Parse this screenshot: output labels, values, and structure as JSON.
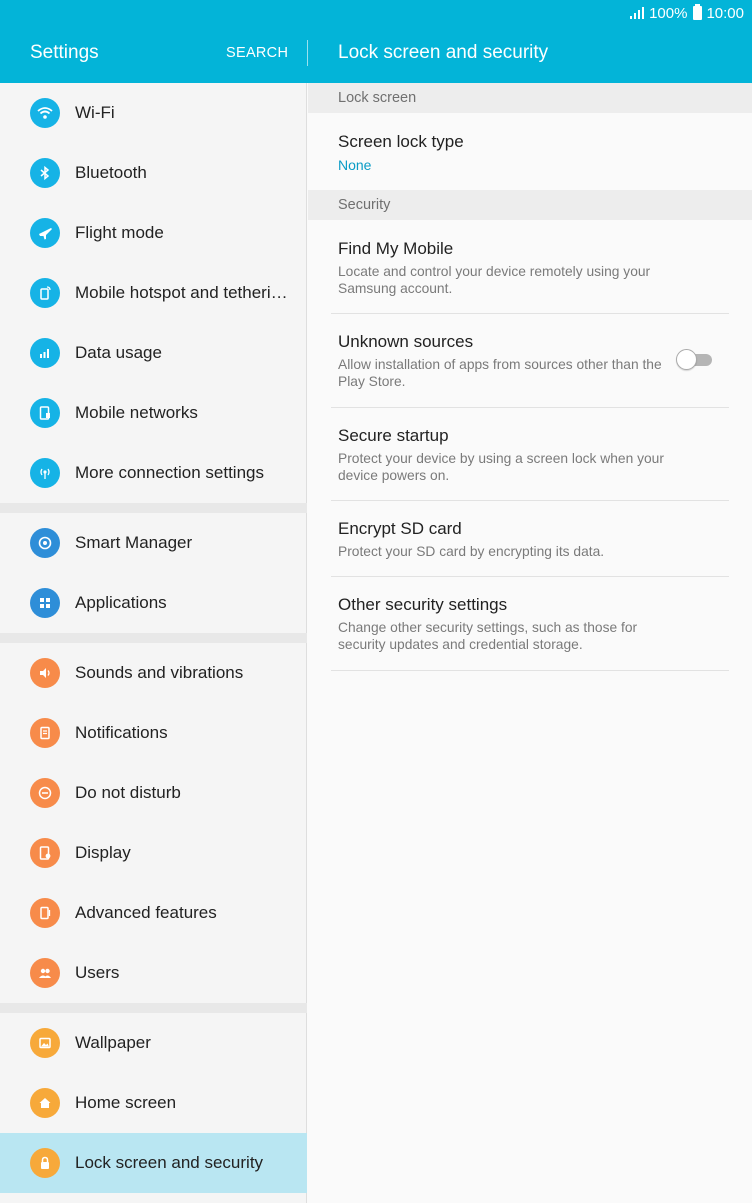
{
  "status_bar": {
    "battery": "100%",
    "time": "10:00"
  },
  "header": {
    "title": "Settings",
    "search_label": "SEARCH",
    "detail_title": "Lock screen and security"
  },
  "sidebar": {
    "items": [
      {
        "label": "Wi-Fi",
        "icon": "wifi-icon"
      },
      {
        "label": "Bluetooth",
        "icon": "bluetooth-icon"
      },
      {
        "label": "Flight mode",
        "icon": "airplane-icon"
      },
      {
        "label": "Mobile hotspot and tetheri…",
        "icon": "hotspot-icon"
      },
      {
        "label": "Data usage",
        "icon": "data-usage-icon"
      },
      {
        "label": "Mobile networks",
        "icon": "mobile-networks-icon"
      },
      {
        "label": "More connection settings",
        "icon": "connection-icon"
      },
      {
        "label": "Smart Manager",
        "icon": "smart-manager-icon"
      },
      {
        "label": "Applications",
        "icon": "applications-icon"
      },
      {
        "label": "Sounds and vibrations",
        "icon": "sound-icon"
      },
      {
        "label": "Notifications",
        "icon": "notifications-icon"
      },
      {
        "label": "Do not disturb",
        "icon": "do-not-disturb-icon"
      },
      {
        "label": "Display",
        "icon": "display-icon"
      },
      {
        "label": "Advanced features",
        "icon": "advanced-features-icon"
      },
      {
        "label": "Users",
        "icon": "users-icon"
      },
      {
        "label": "Wallpaper",
        "icon": "wallpaper-icon"
      },
      {
        "label": "Home screen",
        "icon": "home-icon"
      },
      {
        "label": "Lock screen and security",
        "icon": "lock-icon",
        "selected": true
      }
    ]
  },
  "detail": {
    "lock_screen_section": "Lock screen",
    "screen_lock_type": {
      "title": "Screen lock type",
      "value": "None"
    },
    "security_section": "Security",
    "find_my_mobile": {
      "title": "Find My Mobile",
      "subtitle": "Locate and control your device remotely using your Samsung account."
    },
    "unknown_sources": {
      "title": "Unknown sources",
      "subtitle": "Allow installation of apps from sources other than the Play Store.",
      "enabled": false
    },
    "secure_startup": {
      "title": "Secure startup",
      "subtitle": "Protect your device by using a screen lock when your device powers on."
    },
    "encrypt_sd": {
      "title": "Encrypt SD card",
      "subtitle": "Protect your SD card by encrypting its data."
    },
    "other_security": {
      "title": "Other security settings",
      "subtitle": "Change other security settings, such as those for security updates and credential storage."
    }
  },
  "colors": {
    "header": "#03b4d8",
    "accent": "#0a9cc6",
    "selected_row": "#b9e6f2"
  }
}
